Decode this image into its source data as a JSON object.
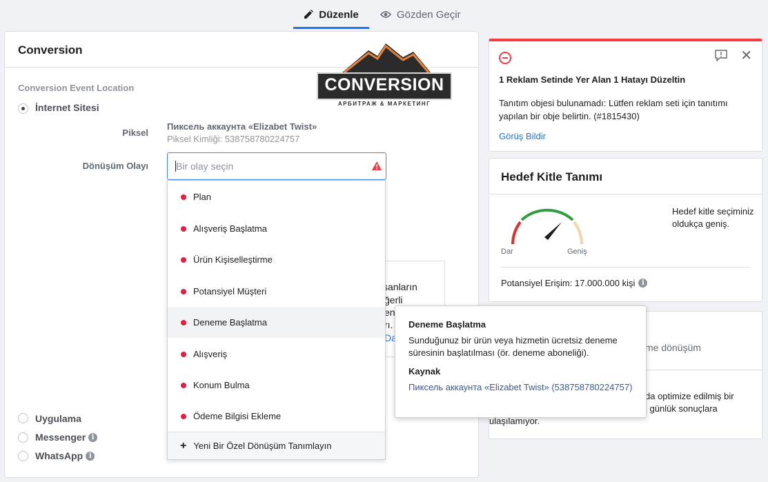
{
  "tabs": {
    "edit_label": "Düzenle",
    "review_label": "Gözden Geçir"
  },
  "conversion": {
    "title": "Conversion",
    "logo_text": "CONVERSION",
    "logo_sub": "АРБИТРАЖ & МАРКЕТИНГ",
    "event_location_label": "Conversion Event Location",
    "location_options": [
      {
        "label": "İnternet Sitesi",
        "selected": true
      },
      {
        "label": "Uygulama",
        "selected": false
      },
      {
        "label": "Messenger",
        "selected": false
      },
      {
        "label": "WhatsApp",
        "selected": false
      }
    ],
    "pixel_label": "Piksel",
    "pixel_name": "Пиксель аккаунта «Elizabet Twist»",
    "pixel_id": "Piksel Kimliği: 538758780224757",
    "event_label": "Dönüşüm Olayı",
    "event_placeholder": "Bir olay seçin",
    "event_value": "",
    "bg_fragments": [
      "sanların",
      "ğerli",
      "en",
      "rı.",
      "Dal"
    ]
  },
  "dropdown": {
    "items": [
      "Plan",
      "Alışveriş Başlatma",
      "Ürün Kişiselleştirme",
      "Potansiyel Müşteri",
      "Deneme Başlatma",
      "Alışveriş",
      "Konum Bulma",
      "Ödeme Bilgisi Ekleme"
    ],
    "hovered_item": "Deneme Başlatma",
    "footer_label": "Yeni Bir Özel Dönüşüm Tanımlayın",
    "dot_color": "#e41e3f"
  },
  "tooltip": {
    "title": "Deneme Başlatma",
    "description": "Sunduğunuz bir ürün veya hizmetin ücretsiz deneme süresinin başlatılması (ör. deneme aboneliği).",
    "source_label": "Kaynak",
    "source_value": "Пиксель аккаунта «Elizabet Twist» (538758780224757)"
  },
  "error_card": {
    "title": "1 Reklam Setinde Yer Alan 1 Hatayı Düzeltin",
    "body": "Tanıtım objesi bulunamadı: Lütfen reklam seti için tanıtımı yapılan bir obje belirtin. (#1815430)",
    "link": "Görüş Bildir",
    "accent_color": "#fa383e"
  },
  "audience": {
    "title": "Hedef Kitle Tanımı",
    "gauge_min_label": "Dar",
    "gauge_max_label": "Geniş",
    "description": "Hedef kitle seçiminiz oldukça geniş.",
    "reach": "Potansiyel Erişim: 17.000.000 kişi"
  },
  "third_card": {
    "line1": "me dönüşüm",
    "line2": "da optimize edilmiş bir",
    "line3": "i günlük sonuçlara",
    "line4": "ulaşılamıyor."
  }
}
